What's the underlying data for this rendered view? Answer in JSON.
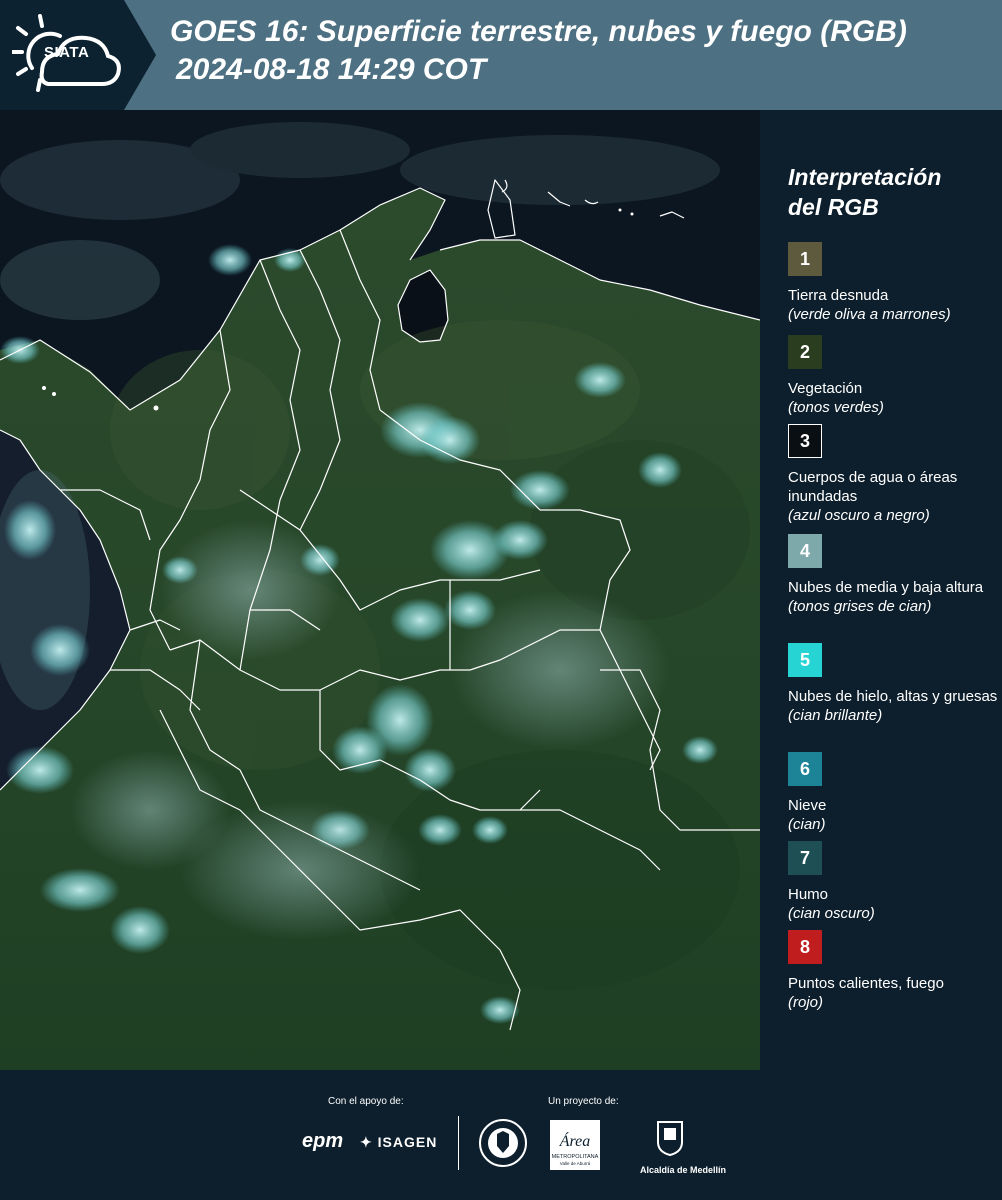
{
  "header": {
    "logo_text": "SIATA",
    "title": "GOES 16: Superficie terrestre, nubes y fuego (RGB)",
    "datetime": "2024-08-18 14:29 COT"
  },
  "legend": {
    "title_line1": "Interpretación",
    "title_line2": "del RGB",
    "items": [
      {
        "num": "1",
        "label": "Tierra desnuda",
        "desc": "(verde oliva a marrones)",
        "color": "#5e5a3e"
      },
      {
        "num": "2",
        "label": "Vegetación",
        "desc": "(tonos verdes)",
        "color": "#2a3d1f"
      },
      {
        "num": "3",
        "label": "Cuerpos de agua o áreas inundadas",
        "desc": "(azul oscuro a negro)",
        "color": "#0a0f14"
      },
      {
        "num": "4",
        "label": "Nubes de media y baja altura",
        "desc": "(tonos grises de cian)",
        "color": "#7ea9aa"
      },
      {
        "num": "5",
        "label": "Nubes de hielo, altas y gruesas",
        "desc": "(cian brillante)",
        "color": "#27d4d4"
      },
      {
        "num": "6",
        "label": "Nieve",
        "desc": "(cian)",
        "color": "#1c8496"
      },
      {
        "num": "7",
        "label": "Humo",
        "desc": "(cian oscuro)",
        "color": "#1d4f54"
      },
      {
        "num": "8",
        "label": "Puntos calientes, fuego",
        "desc": "(rojo)",
        "color": "#c01e1e"
      }
    ]
  },
  "footer": {
    "support_label": "Con el apoyo de:",
    "project_label": "Un proyecto de:",
    "sponsor1": "epm",
    "sponsor2": "ISAGEN",
    "partner1_line1": "METROPOLITANA",
    "partner1_line2": "Valle de Aburrá",
    "partner1_script": "Área",
    "partner2": "Alcaldía de Medellín"
  }
}
